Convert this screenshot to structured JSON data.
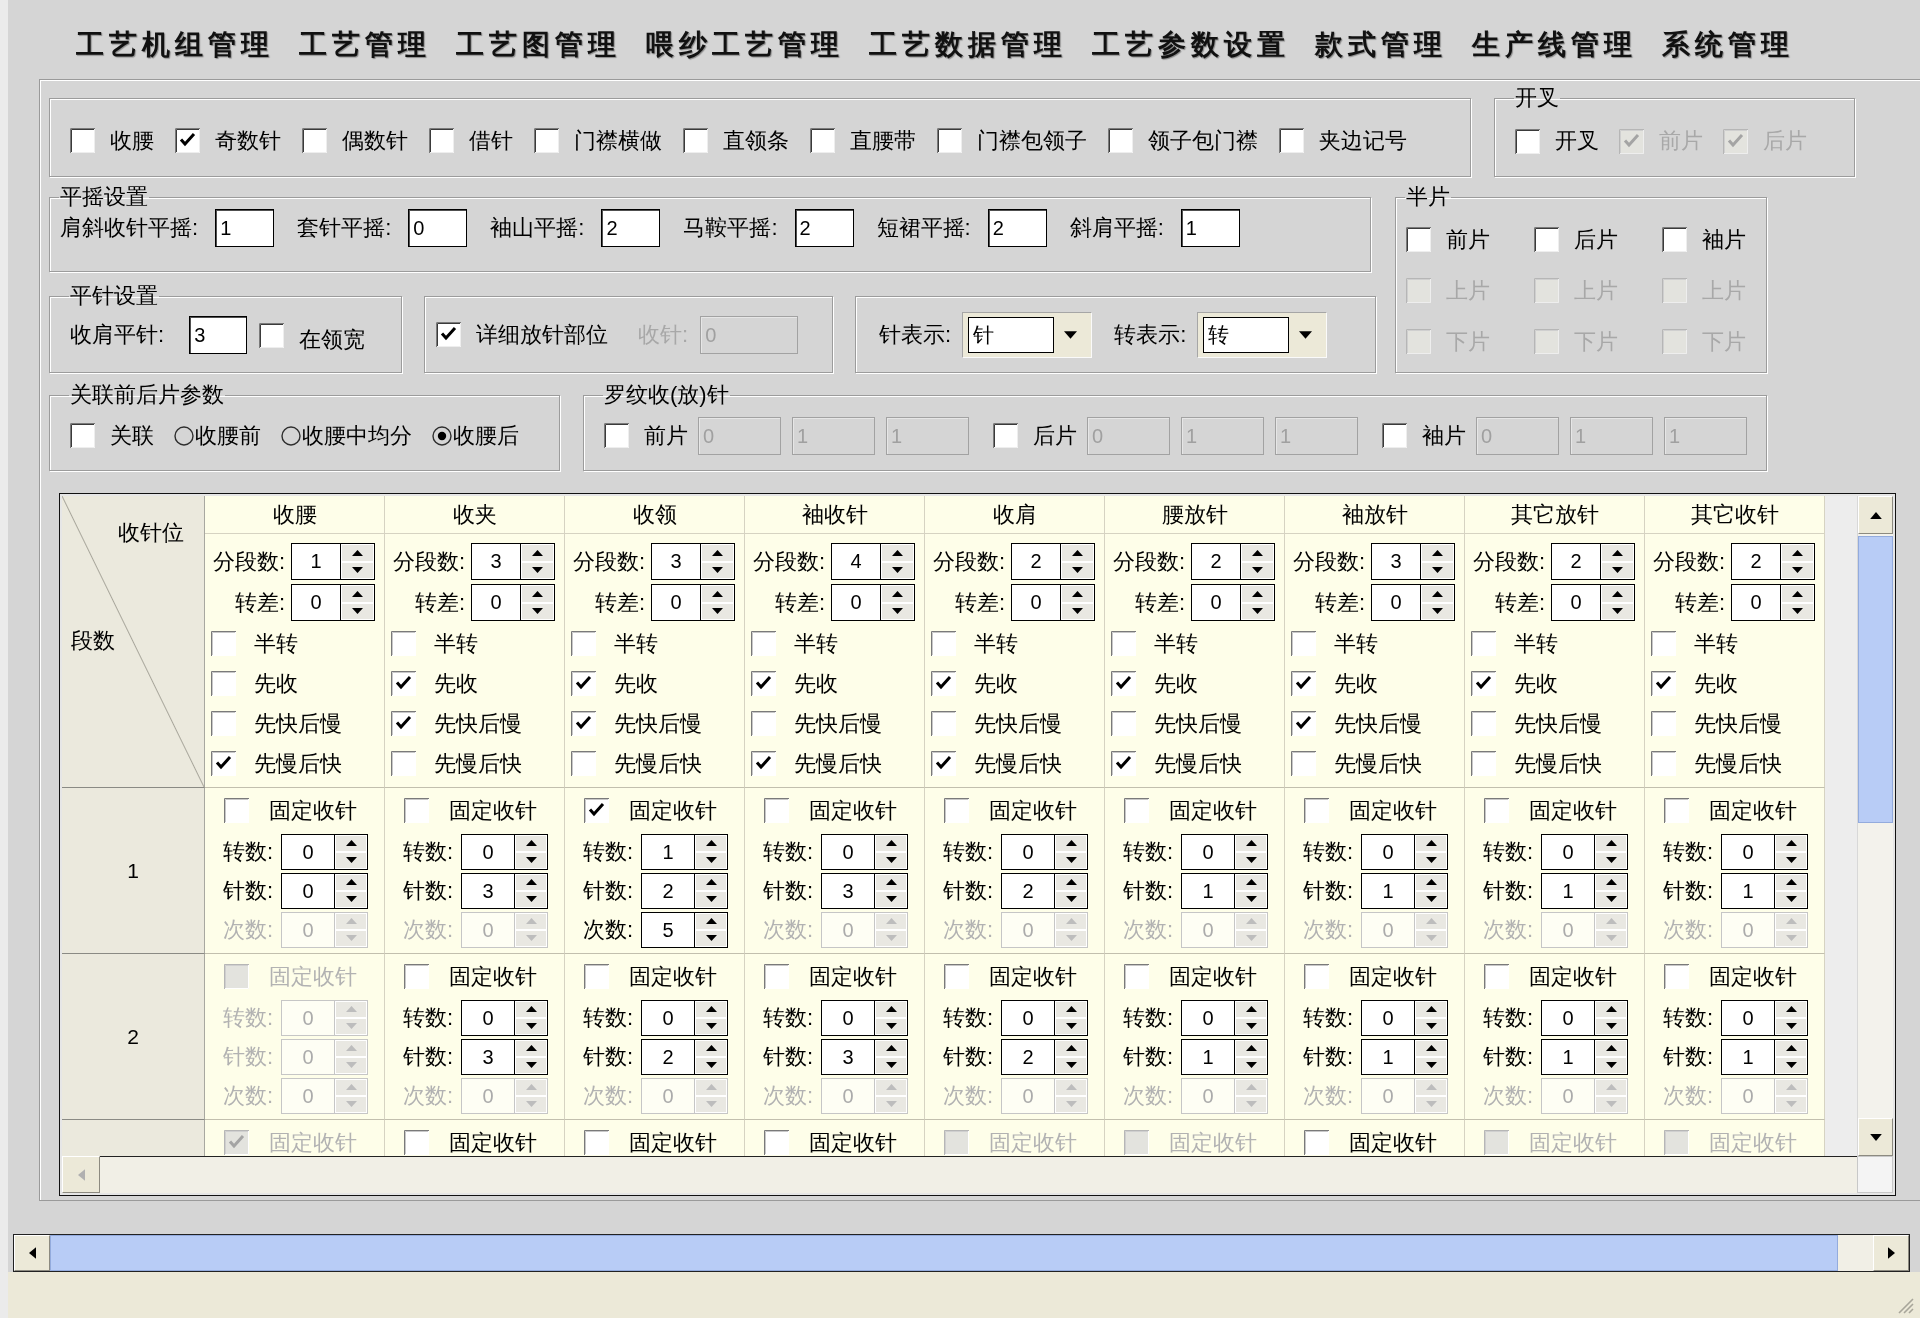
{
  "menu": [
    "工艺机组管理",
    "工艺管理",
    "工艺图管理",
    "喂纱工艺管理",
    "工艺数据管理",
    "工艺参数设置",
    "款式管理",
    "生产线管理",
    "系统管理"
  ],
  "options": [
    {
      "label": "收腰",
      "checked": false
    },
    {
      "label": "奇数针",
      "checked": true
    },
    {
      "label": "偶数针",
      "checked": false
    },
    {
      "label": "借针",
      "checked": false
    },
    {
      "label": "门襟横做",
      "checked": false
    },
    {
      "label": "直领条",
      "checked": false
    },
    {
      "label": "直腰带",
      "checked": false
    },
    {
      "label": "门襟包领子",
      "checked": false
    },
    {
      "label": "领子包门襟",
      "checked": false
    },
    {
      "label": "夹边记号",
      "checked": false
    }
  ],
  "slit": {
    "title": "开叉",
    "options": [
      {
        "label": "开叉",
        "checked": false,
        "disabled": false
      },
      {
        "label": "前片",
        "checked": true,
        "disabled": true
      },
      {
        "label": "后片",
        "checked": true,
        "disabled": true
      }
    ]
  },
  "flat_shake": {
    "title": "平摇设置",
    "fields": [
      {
        "label": "肩斜收针平摇:",
        "value": "1"
      },
      {
        "label": "套针平摇:",
        "value": "0"
      },
      {
        "label": "袖山平摇:",
        "value": "2"
      },
      {
        "label": "马鞍平摇:",
        "value": "2"
      },
      {
        "label": "短裙平摇:",
        "value": "2"
      },
      {
        "label": "斜肩平摇:",
        "value": "1"
      }
    ]
  },
  "half_piece": {
    "title": "半片",
    "rows": [
      {
        "options": [
          {
            "label": "前片",
            "checked": false,
            "disabled": false
          },
          {
            "label": "后片",
            "checked": false,
            "disabled": false
          },
          {
            "label": "袖片",
            "checked": false,
            "disabled": false
          }
        ]
      },
      {
        "options": [
          {
            "label": "上片",
            "checked": false,
            "disabled": true
          },
          {
            "label": "上片",
            "checked": false,
            "disabled": true
          },
          {
            "label": "上片",
            "checked": false,
            "disabled": true
          }
        ]
      },
      {
        "options": [
          {
            "label": "下片",
            "checked": false,
            "disabled": true
          },
          {
            "label": "下片",
            "checked": false,
            "disabled": true
          },
          {
            "label": "下片",
            "checked": false,
            "disabled": true
          }
        ]
      }
    ]
  },
  "flat_stitch": {
    "title": "平针设置",
    "field": {
      "label": "收肩平针:",
      "value": "3"
    },
    "option": {
      "label": "在领宽",
      "checked": false
    }
  },
  "detail_release": {
    "option": {
      "label": "详细放针部位",
      "checked": true
    },
    "field": {
      "label": "收针:",
      "value": "0",
      "disabled": true
    }
  },
  "display_units": [
    {
      "label": "针表示:",
      "value": "针"
    },
    {
      "label": "转表示:",
      "value": "转"
    }
  ],
  "link_params": {
    "title": "关联前后片参数",
    "option": {
      "label": "关联",
      "checked": false
    },
    "radios": [
      {
        "label": "收腰前",
        "selected": false
      },
      {
        "label": "收腰中均分",
        "selected": false
      },
      {
        "label": "收腰后",
        "selected": true
      }
    ]
  },
  "rib": {
    "title": "罗纹收(放)针",
    "pieces": [
      {
        "label": "前片",
        "checked": false,
        "values": [
          {
            "value": "0",
            "disabled": true
          },
          {
            "value": "1",
            "disabled": true
          },
          {
            "value": "1",
            "disabled": true
          }
        ]
      },
      {
        "label": "后片",
        "checked": false,
        "values": [
          {
            "value": "0",
            "disabled": true
          },
          {
            "value": "1",
            "disabled": true
          },
          {
            "value": "1",
            "disabled": true
          }
        ]
      },
      {
        "label": "袖片",
        "checked": false,
        "values": [
          {
            "value": "0",
            "disabled": true
          },
          {
            "value": "1",
            "disabled": true
          },
          {
            "value": "1",
            "disabled": true
          }
        ]
      }
    ]
  },
  "grid": {
    "corner": {
      "column_heading": "收针位",
      "row_heading": "段数"
    },
    "columns": [
      {
        "title": "收腰",
        "spins": [
          {
            "label": "分段数:",
            "value": "1"
          },
          {
            "label": "转差:",
            "value": "0"
          }
        ],
        "options": [
          {
            "label": "半转",
            "checked": false
          },
          {
            "label": "先收",
            "checked": false
          },
          {
            "label": "先快后慢",
            "checked": false
          },
          {
            "label": "先慢后快",
            "checked": true
          }
        ]
      },
      {
        "title": "收夹",
        "spins": [
          {
            "label": "分段数:",
            "value": "3"
          },
          {
            "label": "转差:",
            "value": "0"
          }
        ],
        "options": [
          {
            "label": "半转",
            "checked": false
          },
          {
            "label": "先收",
            "checked": true
          },
          {
            "label": "先快后慢",
            "checked": true
          },
          {
            "label": "先慢后快",
            "checked": false
          }
        ]
      },
      {
        "title": "收领",
        "spins": [
          {
            "label": "分段数:",
            "value": "3"
          },
          {
            "label": "转差:",
            "value": "0"
          }
        ],
        "options": [
          {
            "label": "半转",
            "checked": false
          },
          {
            "label": "先收",
            "checked": true
          },
          {
            "label": "先快后慢",
            "checked": true
          },
          {
            "label": "先慢后快",
            "checked": false
          }
        ]
      },
      {
        "title": "袖收针",
        "spins": [
          {
            "label": "分段数:",
            "value": "4"
          },
          {
            "label": "转差:",
            "value": "0"
          }
        ],
        "options": [
          {
            "label": "半转",
            "checked": false
          },
          {
            "label": "先收",
            "checked": true
          },
          {
            "label": "先快后慢",
            "checked": false
          },
          {
            "label": "先慢后快",
            "checked": true
          }
        ]
      },
      {
        "title": "收肩",
        "spins": [
          {
            "label": "分段数:",
            "value": "2"
          },
          {
            "label": "转差:",
            "value": "0"
          }
        ],
        "options": [
          {
            "label": "半转",
            "checked": false
          },
          {
            "label": "先收",
            "checked": true
          },
          {
            "label": "先快后慢",
            "checked": false
          },
          {
            "label": "先慢后快",
            "checked": true
          }
        ]
      },
      {
        "title": "腰放针",
        "spins": [
          {
            "label": "分段数:",
            "value": "2"
          },
          {
            "label": "转差:",
            "value": "0"
          }
        ],
        "options": [
          {
            "label": "半转",
            "checked": false
          },
          {
            "label": "先收",
            "checked": true
          },
          {
            "label": "先快后慢",
            "checked": false
          },
          {
            "label": "先慢后快",
            "checked": true
          }
        ]
      },
      {
        "title": "袖放针",
        "spins": [
          {
            "label": "分段数:",
            "value": "3"
          },
          {
            "label": "转差:",
            "value": "0"
          }
        ],
        "options": [
          {
            "label": "半转",
            "checked": false
          },
          {
            "label": "先收",
            "checked": true
          },
          {
            "label": "先快后慢",
            "checked": true
          },
          {
            "label": "先慢后快",
            "checked": false
          }
        ]
      },
      {
        "title": "其它放针",
        "spins": [
          {
            "label": "分段数:",
            "value": "2"
          },
          {
            "label": "转差:",
            "value": "0"
          }
        ],
        "options": [
          {
            "label": "半转",
            "checked": false
          },
          {
            "label": "先收",
            "checked": true
          },
          {
            "label": "先快后慢",
            "checked": false
          },
          {
            "label": "先慢后快",
            "checked": false
          }
        ]
      },
      {
        "title": "其它收针",
        "spins": [
          {
            "label": "分段数:",
            "value": "2"
          },
          {
            "label": "转差:",
            "value": "0"
          }
        ],
        "options": [
          {
            "label": "半转",
            "checked": false
          },
          {
            "label": "先收",
            "checked": true
          },
          {
            "label": "先快后慢",
            "checked": false
          },
          {
            "label": "先慢后快",
            "checked": false
          }
        ]
      }
    ],
    "rows": [
      {
        "segment": "1",
        "cells": [
          {
            "fixed": {
              "label": "固定收针",
              "checked": false,
              "disabled": false
            },
            "spins": [
              {
                "label": "转数:",
                "value": "0",
                "disabled": false
              },
              {
                "label": "针数:",
                "value": "0",
                "disabled": false
              },
              {
                "label": "次数:",
                "value": "0",
                "disabled": true
              }
            ]
          },
          {
            "fixed": {
              "label": "固定收针",
              "checked": false,
              "disabled": false
            },
            "spins": [
              {
                "label": "转数:",
                "value": "0",
                "disabled": false
              },
              {
                "label": "针数:",
                "value": "3",
                "disabled": false
              },
              {
                "label": "次数:",
                "value": "0",
                "disabled": true
              }
            ]
          },
          {
            "fixed": {
              "label": "固定收针",
              "checked": true,
              "disabled": false
            },
            "spins": [
              {
                "label": "转数:",
                "value": "1",
                "disabled": false
              },
              {
                "label": "针数:",
                "value": "2",
                "disabled": false
              },
              {
                "label": "次数:",
                "value": "5",
                "disabled": false
              }
            ]
          },
          {
            "fixed": {
              "label": "固定收针",
              "checked": false,
              "disabled": false
            },
            "spins": [
              {
                "label": "转数:",
                "value": "0",
                "disabled": false
              },
              {
                "label": "针数:",
                "value": "3",
                "disabled": false
              },
              {
                "label": "次数:",
                "value": "0",
                "disabled": true
              }
            ]
          },
          {
            "fixed": {
              "label": "固定收针",
              "checked": false,
              "disabled": false
            },
            "spins": [
              {
                "label": "转数:",
                "value": "0",
                "disabled": false
              },
              {
                "label": "针数:",
                "value": "2",
                "disabled": false
              },
              {
                "label": "次数:",
                "value": "0",
                "disabled": true
              }
            ]
          },
          {
            "fixed": {
              "label": "固定收针",
              "checked": false,
              "disabled": false
            },
            "spins": [
              {
                "label": "转数:",
                "value": "0",
                "disabled": false
              },
              {
                "label": "针数:",
                "value": "1",
                "disabled": false
              },
              {
                "label": "次数:",
                "value": "0",
                "disabled": true
              }
            ]
          },
          {
            "fixed": {
              "label": "固定收针",
              "checked": false,
              "disabled": false
            },
            "spins": [
              {
                "label": "转数:",
                "value": "0",
                "disabled": false
              },
              {
                "label": "针数:",
                "value": "1",
                "disabled": false
              },
              {
                "label": "次数:",
                "value": "0",
                "disabled": true
              }
            ]
          },
          {
            "fixed": {
              "label": "固定收针",
              "checked": false,
              "disabled": false
            },
            "spins": [
              {
                "label": "转数:",
                "value": "0",
                "disabled": false
              },
              {
                "label": "针数:",
                "value": "1",
                "disabled": false
              },
              {
                "label": "次数:",
                "value": "0",
                "disabled": true
              }
            ]
          },
          {
            "fixed": {
              "label": "固定收针",
              "checked": false,
              "disabled": false
            },
            "spins": [
              {
                "label": "转数:",
                "value": "0",
                "disabled": false
              },
              {
                "label": "针数:",
                "value": "1",
                "disabled": false
              },
              {
                "label": "次数:",
                "value": "0",
                "disabled": true
              }
            ]
          }
        ]
      },
      {
        "segment": "2",
        "cells": [
          {
            "fixed": {
              "label": "固定收针",
              "checked": false,
              "disabled": true
            },
            "spins": [
              {
                "label": "转数:",
                "value": "0",
                "disabled": true
              },
              {
                "label": "针数:",
                "value": "0",
                "disabled": true
              },
              {
                "label": "次数:",
                "value": "0",
                "disabled": true
              }
            ]
          },
          {
            "fixed": {
              "label": "固定收针",
              "checked": false,
              "disabled": false
            },
            "spins": [
              {
                "label": "转数:",
                "value": "0",
                "disabled": false
              },
              {
                "label": "针数:",
                "value": "3",
                "disabled": false
              },
              {
                "label": "次数:",
                "value": "0",
                "disabled": true
              }
            ]
          },
          {
            "fixed": {
              "label": "固定收针",
              "checked": false,
              "disabled": false
            },
            "spins": [
              {
                "label": "转数:",
                "value": "0",
                "disabled": false
              },
              {
                "label": "针数:",
                "value": "2",
                "disabled": false
              },
              {
                "label": "次数:",
                "value": "0",
                "disabled": true
              }
            ]
          },
          {
            "fixed": {
              "label": "固定收针",
              "checked": false,
              "disabled": false
            },
            "spins": [
              {
                "label": "转数:",
                "value": "0",
                "disabled": false
              },
              {
                "label": "针数:",
                "value": "3",
                "disabled": false
              },
              {
                "label": "次数:",
                "value": "0",
                "disabled": true
              }
            ]
          },
          {
            "fixed": {
              "label": "固定收针",
              "checked": false,
              "disabled": false
            },
            "spins": [
              {
                "label": "转数:",
                "value": "0",
                "disabled": false
              },
              {
                "label": "针数:",
                "value": "2",
                "disabled": false
              },
              {
                "label": "次数:",
                "value": "0",
                "disabled": true
              }
            ]
          },
          {
            "fixed": {
              "label": "固定收针",
              "checked": false,
              "disabled": false
            },
            "spins": [
              {
                "label": "转数:",
                "value": "0",
                "disabled": false
              },
              {
                "label": "针数:",
                "value": "1",
                "disabled": false
              },
              {
                "label": "次数:",
                "value": "0",
                "disabled": true
              }
            ]
          },
          {
            "fixed": {
              "label": "固定收针",
              "checked": false,
              "disabled": false
            },
            "spins": [
              {
                "label": "转数:",
                "value": "0",
                "disabled": false
              },
              {
                "label": "针数:",
                "value": "1",
                "disabled": false
              },
              {
                "label": "次数:",
                "value": "0",
                "disabled": true
              }
            ]
          },
          {
            "fixed": {
              "label": "固定收针",
              "checked": false,
              "disabled": false
            },
            "spins": [
              {
                "label": "转数:",
                "value": "0",
                "disabled": false
              },
              {
                "label": "针数:",
                "value": "1",
                "disabled": false
              },
              {
                "label": "次数:",
                "value": "0",
                "disabled": true
              }
            ]
          },
          {
            "fixed": {
              "label": "固定收针",
              "checked": false,
              "disabled": false
            },
            "spins": [
              {
                "label": "转数:",
                "value": "0",
                "disabled": false
              },
              {
                "label": "针数:",
                "value": "1",
                "disabled": false
              },
              {
                "label": "次数:",
                "value": "0",
                "disabled": true
              }
            ]
          }
        ]
      },
      {
        "cells": [
          {
            "fixed": {
              "label": "固定收针",
              "checked": true,
              "disabled": true
            }
          },
          {
            "fixed": {
              "label": "固定收针",
              "checked": false,
              "disabled": false
            }
          },
          {
            "fixed": {
              "label": "固定收针",
              "checked": false,
              "disabled": false
            }
          },
          {
            "fixed": {
              "label": "固定收针",
              "checked": false,
              "disabled": false
            }
          },
          {
            "fixed": {
              "label": "固定收针",
              "checked": false,
              "disabled": true
            }
          },
          {
            "fixed": {
              "label": "固定收针",
              "checked": false,
              "disabled": true
            }
          },
          {
            "fixed": {
              "label": "固定收针",
              "checked": false,
              "disabled": false
            }
          },
          {
            "fixed": {
              "label": "固定收针",
              "checked": false,
              "disabled": true
            }
          },
          {
            "fixed": {
              "label": "固定收针",
              "checked": false,
              "disabled": true
            }
          }
        ]
      }
    ]
  }
}
